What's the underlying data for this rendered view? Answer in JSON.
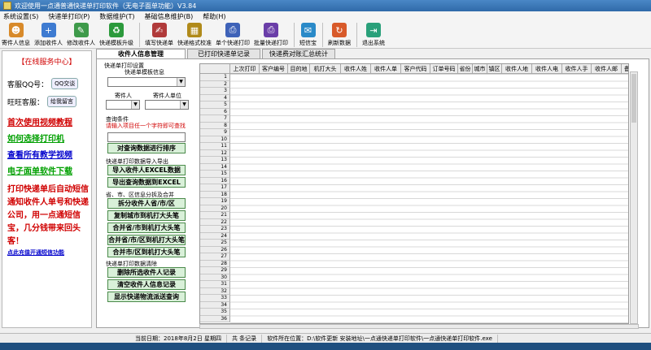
{
  "window": {
    "title": "欢迎使用一点通普通快递单打印软件（无电子面单功能）V3.84"
  },
  "menu": [
    "系统设置(S)",
    "快递单打印(P)",
    "数据维护(T)",
    "基础信息维护(B)",
    "帮助(H)"
  ],
  "toolbar": [
    {
      "label": "寄件人信息",
      "icon": "person-icon",
      "color": "#d88a2a"
    },
    {
      "label": "添加收件人",
      "icon": "person-add-icon",
      "color": "#3e7bd1"
    },
    {
      "label": "修改收件人",
      "icon": "person-edit-icon",
      "color": "#3e9a4a"
    },
    {
      "label": "快递模板升级",
      "icon": "recycle-icon",
      "color": "#2c9a3c"
    },
    {
      "label": "填写快递单",
      "icon": "pen-icon",
      "color": "#b03a3a"
    },
    {
      "label": "快递格式校准",
      "icon": "ruler-icon",
      "color": "#b08a1a"
    },
    {
      "label": "单个快递打印",
      "icon": "printer-icon",
      "color": "#3e62b8"
    },
    {
      "label": "批量快递打印",
      "icon": "printer-batch-icon",
      "color": "#6a3ea8"
    },
    {
      "label": "短信宝",
      "icon": "message-icon",
      "color": "#2a8ac8"
    },
    {
      "label": "刷新数据",
      "icon": "refresh-icon",
      "color": "#d85a2a"
    },
    {
      "label": "退出系统",
      "icon": "exit-icon",
      "color": "#2aa07a"
    }
  ],
  "left": {
    "header": "【在线服务中心】",
    "qq_label": "客服QQ号：",
    "qq_button": "QQ交谈",
    "ww_label": "旺旺客服：",
    "ww_button": "给我留言",
    "links": [
      {
        "text": "首次使用视频教程",
        "color": "#d00000"
      },
      {
        "text": "如何选择打印机",
        "color": "#00a000"
      },
      {
        "text": "查看所有教学视频",
        "color": "#0000cc"
      },
      {
        "text": "电子面单软件下载",
        "color": "#00a000"
      }
    ],
    "notice": "打印快递单后自动短信通知收件人单号和快递公司，用一点通短信宝，几分钱带来回头客！",
    "sms_link": "点此充值开通短信功能"
  },
  "tabs": [
    {
      "label": "收件人信息管理",
      "active": true
    },
    {
      "label": "已打印快递单记录",
      "active": false
    },
    {
      "label": "快递费对账汇总统计",
      "active": false
    }
  ],
  "controls": {
    "print_settings": "快递单打印设置",
    "template_label": "快递单模板信息",
    "sender_label": "寄件人",
    "sender_unit_label": "寄件人单位",
    "query_section": "查询条件",
    "query_hint": "请输入项目任一个字符即可查找",
    "query_button": "对查询数据进行排序",
    "import_export": "快递单打印数据导入导出",
    "import_button": "导入收件人EXCEL数据",
    "export_button": "导出查询数据到EXCEL",
    "split_section": "省、市、区信息分拆及合并",
    "split_buttons": [
      "拆分收件人省/市/区",
      "复制城市到机打大头笔",
      "合并省/市到机打大头笔",
      "合并省/市/区到机打大头笔",
      "合并市/区到机打大头笔"
    ],
    "clear_section": "快递单打印数据清除",
    "clear_buttons": [
      "删除所选收件人记录",
      "清空收件人信息记录",
      "显示快递物流派送查询"
    ]
  },
  "grid": {
    "columns": [
      "上次打印",
      "客户编号",
      "目的地",
      "机打大头",
      "收件人姓",
      "收件人单",
      "客户代码",
      "订单号码",
      "省份",
      "城市",
      "镇区",
      "收件人地",
      "收件人电",
      "收件人手",
      "收件人邮",
      "备"
    ],
    "row_numbers": [
      "1",
      "2",
      "3",
      "4",
      "5",
      "6",
      "7",
      "8",
      "9",
      "10",
      "11",
      "12",
      "13",
      "14",
      "15",
      "16",
      "17",
      "18",
      "19",
      "20",
      "21",
      "22",
      "23",
      "24",
      "25",
      "26",
      "27",
      "28",
      "29",
      "30",
      "31",
      "32",
      "33",
      "34",
      "35",
      "36"
    ]
  },
  "status": {
    "date": "当前日期：2018年8月2日 星期四",
    "records": "共  条记录",
    "location": "软件所在位置：D:\\软件更新 安装地址\\一点通快递单打印软件\\一点通快递单打印软件.exe"
  }
}
